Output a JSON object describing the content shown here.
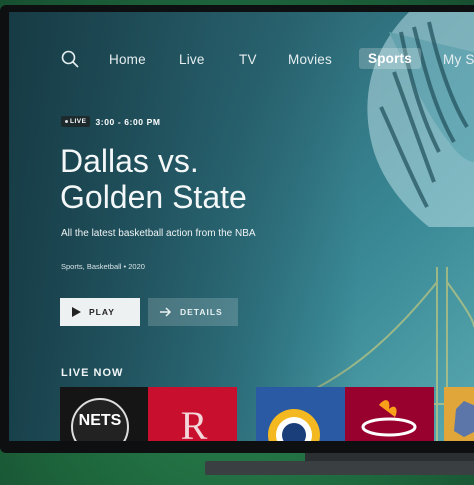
{
  "nav": {
    "items": [
      {
        "label": "Home"
      },
      {
        "label": "Live"
      },
      {
        "label": "TV"
      },
      {
        "label": "Movies"
      },
      {
        "label": "Sports",
        "active": true
      },
      {
        "label": "My S"
      }
    ]
  },
  "hero": {
    "live_badge": "LIVE",
    "time": "3:00 - 6:00 PM",
    "title_line1": "Dallas vs.",
    "title_line2": "Golden State",
    "subtitle": "All the latest basketball action from the NBA",
    "meta": "Sports, Basketball • 2020",
    "play_label": "PLAY",
    "details_label": "DETAILS"
  },
  "live_now": {
    "title": "LIVE NOW",
    "tiles": [
      {
        "team_text": "NETS",
        "color": "#1a1a1a"
      },
      {
        "team_text": "R",
        "color": "#c8102e"
      },
      {
        "team_text": "",
        "color": "#1a4a8c"
      },
      {
        "team_text": "",
        "color": "#98002e"
      },
      {
        "team_text": "",
        "color": "#e0a63a"
      }
    ]
  },
  "colors": {
    "background_green": "#1f6b3f",
    "screen_teal": "#2d6a77",
    "play_button": "#eef1f2"
  }
}
